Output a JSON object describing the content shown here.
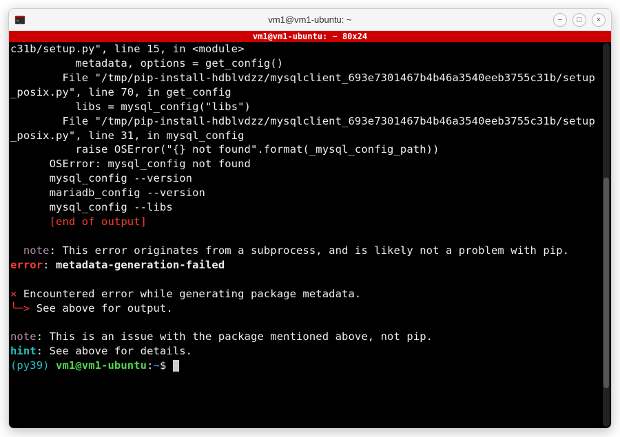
{
  "window": {
    "title": "vm1@vm1-ubuntu: ~"
  },
  "redbar": {
    "text": "vm1@vm1-ubuntu: ~ 80x24"
  },
  "term": {
    "l1": "c31b/setup.py\", line 15, in <module>",
    "l2": "          metadata, options = get_config()",
    "l3": "        File \"/tmp/pip-install-hdblvdzz/mysqlclient_693e7301467b4b46a3540eeb3755c31b/setup_posix.py\", line 70, in get_config",
    "l4": "          libs = mysql_config(\"libs\")",
    "l5": "        File \"/tmp/pip-install-hdblvdzz/mysqlclient_693e7301467b4b46a3540eeb3755c31b/setup_posix.py\", line 31, in mysql_config",
    "l6": "          raise OSError(\"{} not found\".format(_mysql_config_path))",
    "l7": "      OSError: mysql_config not found",
    "l8": "      mysql_config --version",
    "l9": "      mariadb_config --version",
    "l10": "      mysql_config --libs",
    "l11_pre": "      ",
    "l11_red": "[end of output]",
    "note_label": "  note",
    "note1_text": ": This error originates from a subprocess, and is likely not a problem with pip.",
    "error_label": "error",
    "error_text": ": ",
    "error_bold": "metadata-generation-failed",
    "x": "×",
    "enc": " Encountered error while generating package metadata.",
    "arrow": "╰─>",
    "see_above": " See above for output.",
    "note2_label": "note",
    "note2_text": ": This is an issue with the package mentioned above, not pip.",
    "hint_label": "hint",
    "hint_text": ": See above for details.",
    "venv": "(py39) ",
    "userhost": "vm1@vm1-ubuntu",
    "colon": ":",
    "path": "~",
    "dollar": "$ "
  },
  "icons": {
    "minimize": "−",
    "maximize": "□",
    "close": "×"
  }
}
